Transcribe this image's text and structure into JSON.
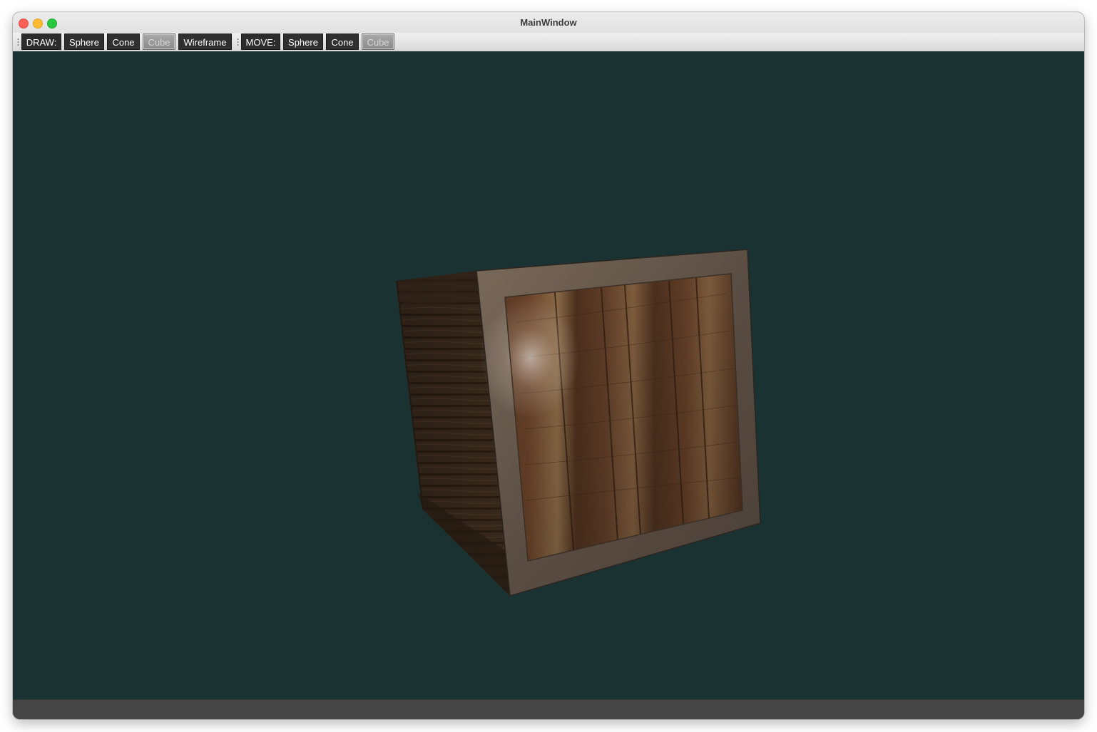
{
  "window": {
    "title": "MainWindow"
  },
  "toolbar": {
    "draw_label": "DRAW:",
    "draw_sphere": "Sphere",
    "draw_cone": "Cone",
    "draw_cube": "Cube",
    "draw_wireframe": "Wireframe",
    "move_label": "MOVE:",
    "move_sphere": "Sphere",
    "move_cone": "Cone",
    "move_cube": "Cube"
  },
  "colors": {
    "viewport_background": "#1b3233",
    "toolbar_button": "#2f2f2f",
    "active_button": "#9a9a9a",
    "statusbar": "#454545"
  },
  "viewport": {
    "object": "textured-wooden-crate-cube"
  }
}
